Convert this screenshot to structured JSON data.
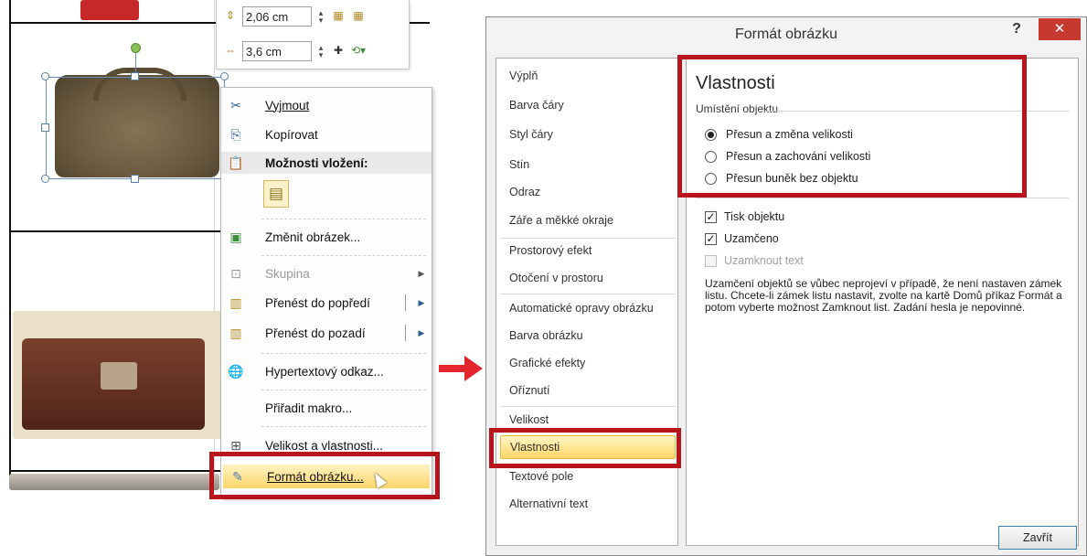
{
  "mini_toolbar": {
    "height_value": "2,06 cm",
    "width_value": "3,6 cm"
  },
  "context_menu": {
    "items": [
      {
        "label": "Vyjmout",
        "icon": "scissors-icon"
      },
      {
        "label": "Kopírovat",
        "icon": "copy-icon"
      },
      {
        "label": "Možnosti vložení:",
        "icon": "paste-icon"
      },
      {
        "label": "Změnit obrázek...",
        "icon": "change-picture-icon"
      },
      {
        "label": "Skupina",
        "icon": "group-icon"
      },
      {
        "label": "Přenést do popředí",
        "icon": "bring-forward-icon"
      },
      {
        "label": "Přenést do pozadí",
        "icon": "send-backward-icon"
      },
      {
        "label": "Hypertextový odkaz...",
        "icon": "hyperlink-icon"
      },
      {
        "label": "Přiřadit makro...",
        "icon": ""
      },
      {
        "label": "Velikost a vlastnosti...",
        "icon": "size-properties-icon"
      },
      {
        "label": "Formát obrázku...",
        "icon": "format-picture-icon"
      }
    ]
  },
  "dialog": {
    "title": "Formát obrázku",
    "help": "?",
    "close": "✕",
    "nav": [
      "Výplň",
      "Barva čáry",
      "Styl čáry",
      "Stín",
      "Odraz",
      "Záře a měkké okraje",
      "Prostorový efekt",
      "Otočení v prostoru",
      "Automatické opravy obrázku",
      "Barva obrázku",
      "Grafické efekty",
      "Oříznutí",
      "Velikost",
      "Vlastnosti",
      "Textové pole",
      "Alternativní text"
    ],
    "selected_nav": "Vlastnosti",
    "section_title": "Vlastnosti",
    "group_label": "Umístění objektu",
    "radios": [
      {
        "label": "Přesun a změna velikosti",
        "checked": true
      },
      {
        "label": "Přesun a zachování velikosti",
        "checked": false
      },
      {
        "label": "Přesun buněk bez objektu",
        "checked": false
      }
    ],
    "checks": [
      {
        "label": "Tisk objektu",
        "checked": true,
        "disabled": false
      },
      {
        "label": "Uzamčeno",
        "checked": true,
        "disabled": false
      },
      {
        "label": "Uzamknout text",
        "checked": false,
        "disabled": true
      }
    ],
    "info_text": "Uzamčení objektů se vůbec neprojeví v případě, že není nastaven zámek listu. Chcete-li zámek listu nastavit, zvolte na kartě Domů příkaz Formát a potom vyberte možnost Zamknout list. Zadání hesla je nepovinné.",
    "close_button": "Zavřít"
  },
  "colors": {
    "highlight_border": "#b8141d",
    "selected_bg": "#fbd768",
    "close_red": "#c7382f",
    "arrow_red": "#e3262b"
  }
}
